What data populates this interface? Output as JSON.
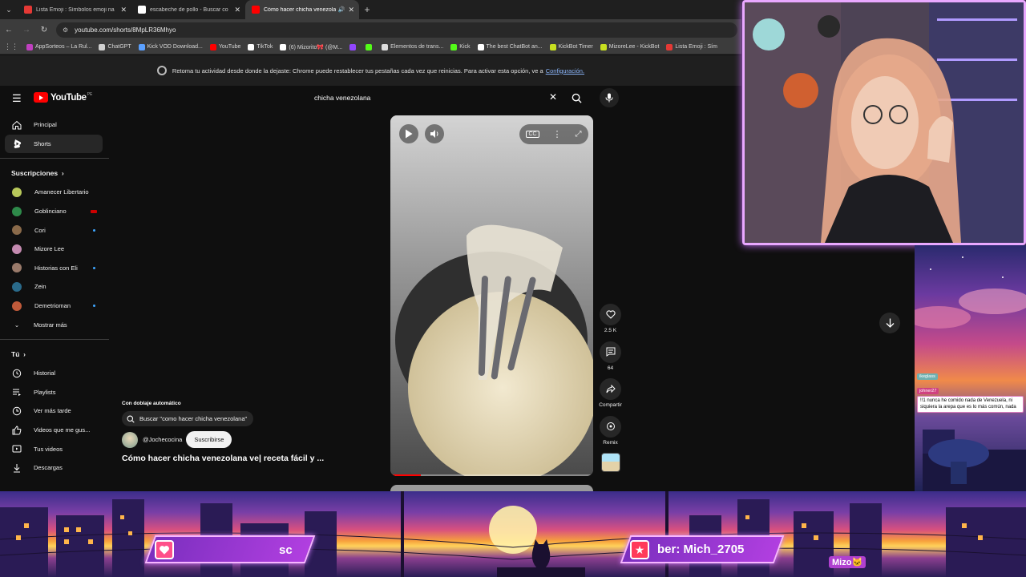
{
  "browser": {
    "tabs": [
      {
        "title": "Lista Emoji : Símbolos emoji na",
        "fav_color": "#e53935",
        "active": false
      },
      {
        "title": "escabeche de pollo - Buscar co",
        "fav_color": "#ffffff",
        "active": false
      },
      {
        "title": "Cómo hacer chicha venezola",
        "fav_color": "#ff0000",
        "active": true
      }
    ],
    "new_tab": "+",
    "url": "youtube.com/shorts/8MpLR36Mhyo",
    "bookmarks": [
      {
        "label": "AppSorteos – La Rul...",
        "color": "#c040c0"
      },
      {
        "label": "ChatGPT",
        "color": "#d0d0d0"
      },
      {
        "label": "Kick VOD Download...",
        "color": "#5aa0ff"
      },
      {
        "label": "YouTube",
        "color": "#ff0000"
      },
      {
        "label": "TikTok",
        "color": "#ffffff"
      },
      {
        "label": "(6) Mizorito🎀 (@M...",
        "color": "#ffffff"
      },
      {
        "label": "",
        "color": "#9146ff"
      },
      {
        "label": "",
        "color": "#53fc18"
      },
      {
        "label": "Elementos de trans...",
        "color": "#dddddd"
      },
      {
        "label": "Kick",
        "color": "#53fc18"
      },
      {
        "label": "The best ChatBot an...",
        "color": "#ffffff"
      },
      {
        "label": "KickBot Timer",
        "color": "#c8e020"
      },
      {
        "label": "MizoreLee - KickBot",
        "color": "#c8e020"
      },
      {
        "label": "Lista Emoji : Sím",
        "color": "#e53935"
      }
    ],
    "infobar": {
      "text": "Retoma tu actividad desde donde la dejaste: Chrome puede restablecer tus pestañas cada vez que reinicias. Para activar esta opción, ve a",
      "link": "Configuración."
    }
  },
  "youtube": {
    "logo": "YouTube",
    "region": "PE",
    "search_value": "chicha venezolana",
    "sidebar": {
      "main": [
        {
          "label": "Principal",
          "icon": "home-icon"
        },
        {
          "label": "Shorts",
          "icon": "shorts-icon",
          "active": true
        }
      ],
      "subs_heading": "Suscripciones",
      "subs": [
        {
          "label": "Amanecer Libertario",
          "color": "#b8c85a",
          "badge": ""
        },
        {
          "label": "Goblinciano",
          "color": "#2e8a4a",
          "badge": "live"
        },
        {
          "label": "Cori",
          "color": "#8a6a4a",
          "badge": "dot"
        },
        {
          "label": "Mizore Lee",
          "color": "#c48ab0",
          "badge": ""
        },
        {
          "label": "Historias con Eli",
          "color": "#9a7a6a",
          "badge": "dot"
        },
        {
          "label": "Zein",
          "color": "#2a6a8a",
          "badge": ""
        },
        {
          "label": "Demetrioman",
          "color": "#c05a3a",
          "badge": "dot"
        }
      ],
      "more": "Mostrar más",
      "you_heading": "Tú",
      "you": [
        {
          "label": "Historial",
          "icon": "history-icon"
        },
        {
          "label": "Playlists",
          "icon": "playlists-icon"
        },
        {
          "label": "Ver más tarde",
          "icon": "clock-icon"
        },
        {
          "label": "Videos que me gus...",
          "icon": "thumbs-up-icon"
        },
        {
          "label": "Tus videos",
          "icon": "video-icon"
        },
        {
          "label": "Descargas",
          "icon": "download-icon"
        }
      ]
    },
    "short": {
      "dubbing": "Con doblaje automático",
      "search_suggestion": "Buscar \"como hacer chicha venezolana\"",
      "channel": "@Jochecocina",
      "subscribe": "Suscribirse",
      "title": "Cómo hacer chicha venezolana ve| receta fácil y ...",
      "progress": 0.15,
      "likes": "2.5 K",
      "comments": "64",
      "share": "Compartir",
      "remix": "Remix"
    }
  },
  "stream": {
    "chat": [
      {
        "user": "ikeglass",
        "text": ""
      },
      {
        "user": "johner27",
        "text": "!!1 nunca he comido nada de Venezuela, ni siquiera la arepa que es lo más común, nada"
      }
    ],
    "banner_left": "sc",
    "banner_right": "ber: Mich_2705",
    "tag": "Mizo🐱"
  }
}
